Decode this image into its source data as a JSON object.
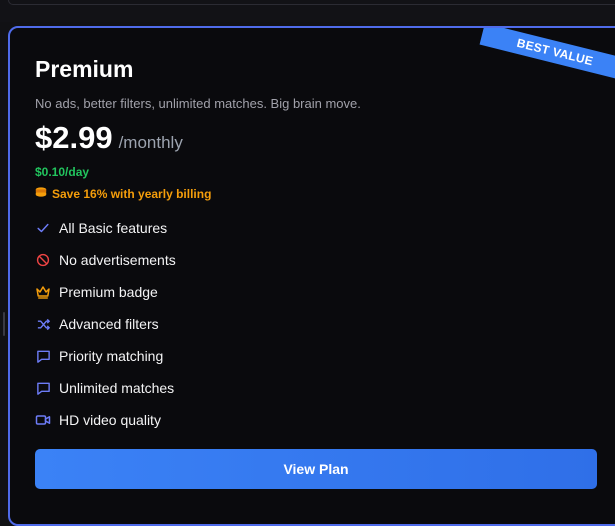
{
  "plan": {
    "name": "Premium",
    "tagline": "No ads, better filters, unlimited matches. Big brain move.",
    "price": "$2.99",
    "period": "/monthly",
    "per_day": "$0.10/day",
    "savings_text": "Save 16% with yearly billing",
    "badge": "BEST VALUE",
    "features": [
      {
        "label": "All Basic features",
        "icon": "check-icon",
        "color": "#6d7cf7"
      },
      {
        "label": "No advertisements",
        "icon": "no-ads-icon",
        "color": "#ef4444"
      },
      {
        "label": "Premium badge",
        "icon": "crown-icon",
        "color": "#f59e0b"
      },
      {
        "label": "Advanced filters",
        "icon": "shuffle-icon",
        "color": "#6d7cf7"
      },
      {
        "label": "Priority matching",
        "icon": "message-square-icon",
        "color": "#6d7cf7"
      },
      {
        "label": "Unlimited matches",
        "icon": "message-square-icon",
        "color": "#6d7cf7"
      },
      {
        "label": "HD video quality",
        "icon": "video-icon",
        "color": "#6d7cf7"
      }
    ],
    "cta_label": "View Plan"
  },
  "colors": {
    "accent": "#3b82f6",
    "card_border": "#4f6bea",
    "per_day": "#22c55e",
    "savings": "#f59e0b"
  }
}
